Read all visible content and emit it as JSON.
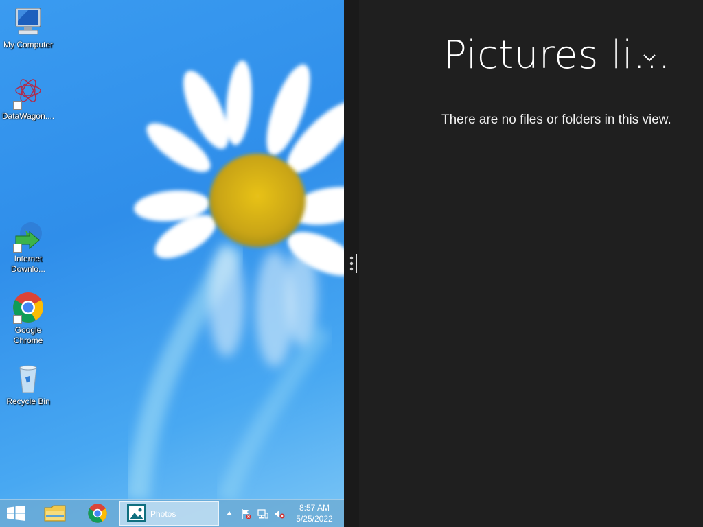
{
  "desktop": {
    "icons": [
      {
        "name": "my-computer",
        "label": "My Computer"
      },
      {
        "name": "datawagon",
        "label": "DataWagon...."
      },
      {
        "name": "internet-download-manager",
        "label": "Internet Downlo..."
      },
      {
        "name": "google-chrome",
        "label": "Google Chrome"
      },
      {
        "name": "recycle-bin",
        "label": "Recycle Bin"
      }
    ]
  },
  "taskbar": {
    "start_icon": "windows-logo-icon",
    "pinned": [
      "file-explorer-icon",
      "chrome-icon"
    ],
    "active_app": {
      "label": "Photos",
      "icon": "photos-icon"
    },
    "tray": [
      "show-hidden-icons-icon",
      "action-center-flag-icon",
      "network-icon",
      "volume-muted-icon"
    ],
    "clock": {
      "time": "8:57 AM",
      "date": "5/25/2022"
    }
  },
  "pictures_pane": {
    "title": "Pictures li...",
    "empty_message": "There are no files or folders in this view."
  },
  "colors": {
    "pane_background": "#1f1f1f",
    "desktop_sky": "#3a9bf0",
    "taskbar": "#6eaad2"
  }
}
